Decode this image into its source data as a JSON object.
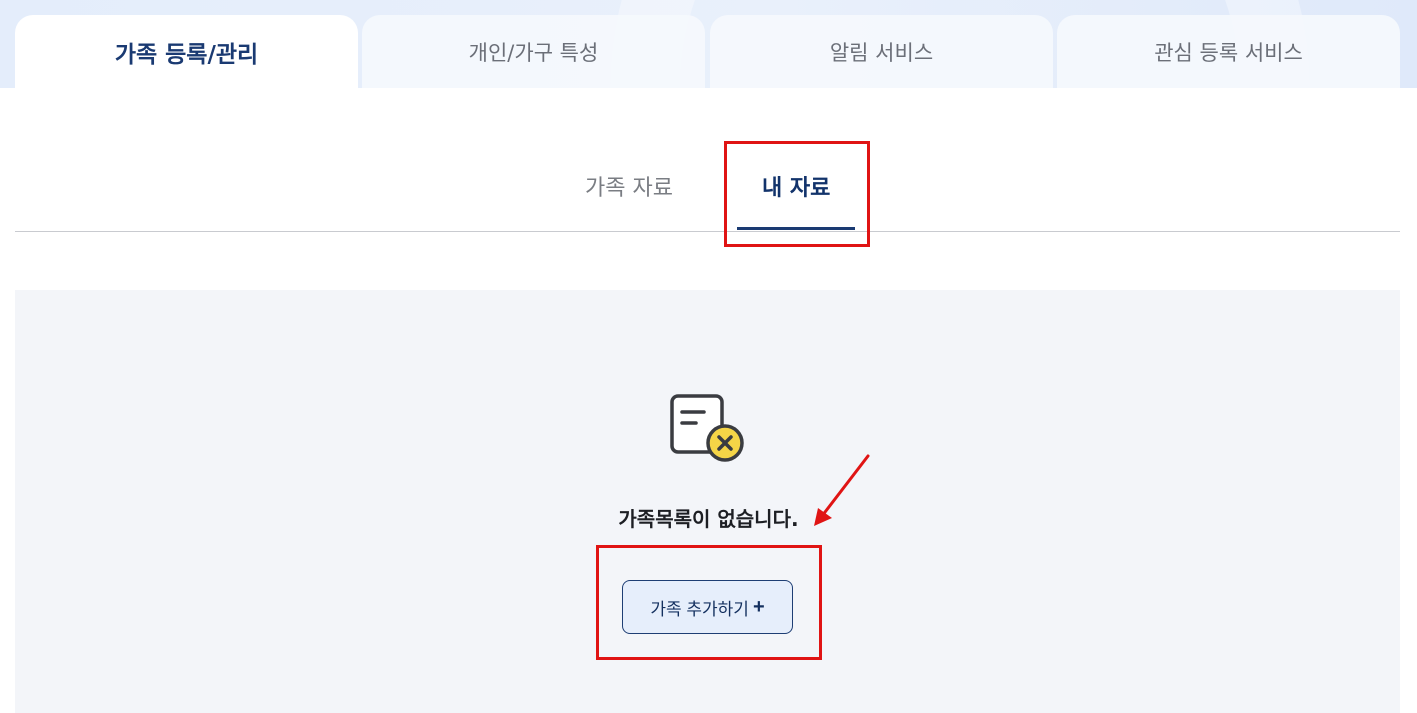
{
  "main_tabs": [
    {
      "label": "가족 등록/관리",
      "active": true
    },
    {
      "label": "개인/가구 특성",
      "active": false
    },
    {
      "label": "알림 서비스",
      "active": false
    },
    {
      "label": "관심 등록 서비스",
      "active": false
    }
  ],
  "sub_tabs": [
    {
      "label": "가족 자료",
      "active": false
    },
    {
      "label": "내 자료",
      "active": true
    }
  ],
  "empty_state": {
    "icon": "document-x-icon",
    "message": "가족목록이 없습니다.",
    "add_button_label": "가족 추가하기",
    "add_button_symbol": "+"
  },
  "colors": {
    "accent": "#1a3a72",
    "highlight": "#e01414",
    "icon_badge": "#f5d547"
  }
}
